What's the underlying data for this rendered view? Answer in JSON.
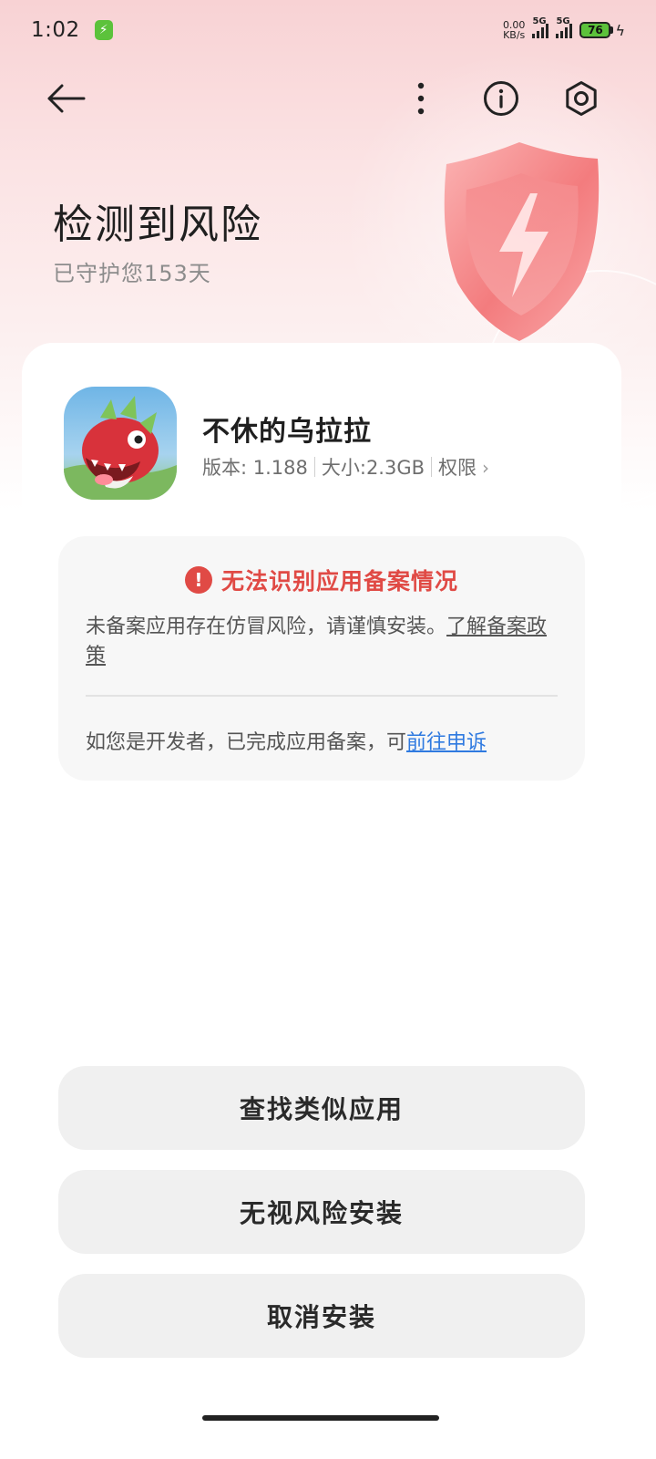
{
  "status_bar": {
    "time": "1:02",
    "net_speed_value": "0.00",
    "net_speed_unit": "KB/s",
    "signal1_label": "5G",
    "signal2_label": "5G",
    "battery_level": "76"
  },
  "hero": {
    "title": "检测到风险",
    "subtitle": "已守护您153天"
  },
  "app": {
    "name": "不休的乌拉拉",
    "version_label": "版本: 1.188",
    "size_label": "大小:2.3GB",
    "permissions_label": "权限"
  },
  "warning": {
    "title": "无法识别应用备案情况",
    "description": "未备案应用存在仿冒风险，请谨慎安装。",
    "policy_link": "了解备案政策",
    "developer_text": "如您是开发者，已完成应用备案，可",
    "appeal_link": "前往申诉"
  },
  "buttons": {
    "find_similar": "查找类似应用",
    "ignore_install": "无视风险安装",
    "cancel_install": "取消安装"
  },
  "colors": {
    "warning_red": "#e04a45",
    "link_blue": "#2f7ae0",
    "button_bg": "#f0f0f0"
  }
}
